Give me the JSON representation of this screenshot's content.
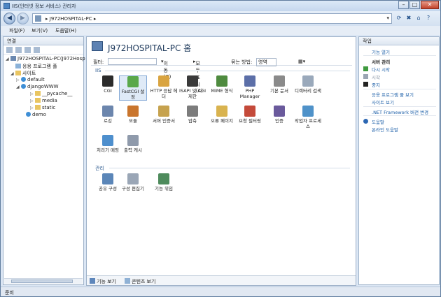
{
  "window": {
    "title": "IIS(인터넷 정보 서비스) 관리자"
  },
  "address": {
    "crumb": "J972HOSPITAL-PC"
  },
  "menu": [
    "파일(F)",
    "보기(V)",
    "도움말(H)"
  ],
  "connections": {
    "title": "연결",
    "tree": [
      {
        "label": "J972HOSPITAL-PC(J972Hosp",
        "icon": "computer-icon",
        "expander": "◢"
      },
      {
        "label": "응용 프로그램 풀",
        "icon": "app-pool-icon",
        "expander": ""
      },
      {
        "label": "사이트",
        "icon": "sites-folder-icon",
        "expander": "◢"
      },
      {
        "label": "default",
        "icon": "site-globe-icon",
        "expander": "▷"
      },
      {
        "label": "djangoWWW",
        "icon": "site-globe-icon",
        "expander": "◢"
      },
      {
        "label": "__pycache__",
        "icon": "folder-icon",
        "expander": "▷"
      },
      {
        "label": "media",
        "icon": "folder-icon",
        "expander": "▷"
      },
      {
        "label": "static",
        "icon": "folder-icon",
        "expander": "▷"
      },
      {
        "label": "demo",
        "icon": "site-globe-icon",
        "expander": ""
      }
    ]
  },
  "main": {
    "title": "J972HOSPITAL-PC 홈",
    "filter_label": "필터:",
    "go_label": "이동(G)",
    "show_all_label": "모두 표시(A)",
    "group_by_label": "묶는 방법:",
    "group_by_value": "영역",
    "groups": [
      {
        "name": "IIS",
        "features": [
          {
            "label": "CGI",
            "icon": "cgi-icon",
            "color": "#2b2b2b"
          },
          {
            "label": "FastCGI 설정",
            "icon": "fastcgi-icon",
            "color": "#5aa84a",
            "selected": true
          },
          {
            "label": "HTTP 응답 헤더",
            "icon": "http-headers-icon",
            "color": "#d9a441"
          },
          {
            "label": "ISAPI 및 CGI 제한",
            "icon": "isapi-cgi-icon",
            "color": "#3a3a3a"
          },
          {
            "label": "MIME 형식",
            "icon": "mime-icon",
            "color": "#4f8b3f"
          },
          {
            "label": "PHP Manager",
            "icon": "php-manager-icon",
            "color": "#5c6fa8"
          },
          {
            "label": "기본 문서",
            "icon": "default-document-icon",
            "color": "#8a8a8a"
          },
          {
            "label": "디렉터리 검색",
            "icon": "directory-browsing-icon",
            "color": "#9aa9bb"
          },
          {
            "label": "로깅",
            "icon": "logging-icon",
            "color": "#6c86ad"
          },
          {
            "label": "모듈",
            "icon": "modules-icon",
            "color": "#c9752d"
          },
          {
            "label": "서버 인증서",
            "icon": "server-certificates-icon",
            "color": "#c6a24e"
          },
          {
            "label": "압축",
            "icon": "compression-icon",
            "color": "#7c7c7c"
          },
          {
            "label": "오류 페이지",
            "icon": "error-pages-icon",
            "color": "#d9b34f"
          },
          {
            "label": "요청 필터링",
            "icon": "request-filtering-icon",
            "color": "#c44a3a"
          },
          {
            "label": "인증",
            "icon": "authentication-icon",
            "color": "#6a5a9c"
          },
          {
            "label": "작업자 프로세스",
            "icon": "worker-processes-icon",
            "color": "#4f92c9"
          },
          {
            "label": "처리기 매핑",
            "icon": "handler-mappings-icon",
            "color": "#4e8fcd"
          },
          {
            "label": "출력 캐시",
            "icon": "output-caching-icon",
            "color": "#8f9aab"
          }
        ]
      },
      {
        "name": "관리",
        "features": [
          {
            "label": "공유 구성",
            "icon": "shared-config-icon",
            "color": "#5b86b8"
          },
          {
            "label": "구성 편집기",
            "icon": "config-editor-icon",
            "color": "#9aa6b6"
          },
          {
            "label": "기능 위임",
            "icon": "feature-delegation-icon",
            "color": "#4e8b5c"
          }
        ]
      }
    ],
    "views": [
      "기능 보기",
      "콘텐츠 보기"
    ]
  },
  "actions": {
    "title": "작업",
    "items": [
      {
        "label": "기능 열기",
        "type": "link"
      },
      {
        "label": "서버 관리",
        "type": "head"
      },
      {
        "label": "다시 시작",
        "type": "link",
        "icon": "restart-icon",
        "color": "#3f9a3f"
      },
      {
        "label": "시작",
        "type": "disabled",
        "icon": "start-icon",
        "color": "#9aa5b3"
      },
      {
        "label": "중지",
        "type": "link",
        "icon": "stop-icon",
        "color": "#222222"
      },
      {
        "label": "응용 프로그램 풀 보기",
        "type": "link"
      },
      {
        "label": "사이트 보기",
        "type": "link"
      },
      {
        "label": ".NET Framework 버전 변경",
        "type": "link"
      },
      {
        "label": "도움말",
        "type": "link",
        "icon": "help-icon",
        "color": "#2c67b3"
      },
      {
        "label": "온라인 도움말",
        "type": "link"
      }
    ]
  },
  "status": {
    "text": "준비"
  }
}
